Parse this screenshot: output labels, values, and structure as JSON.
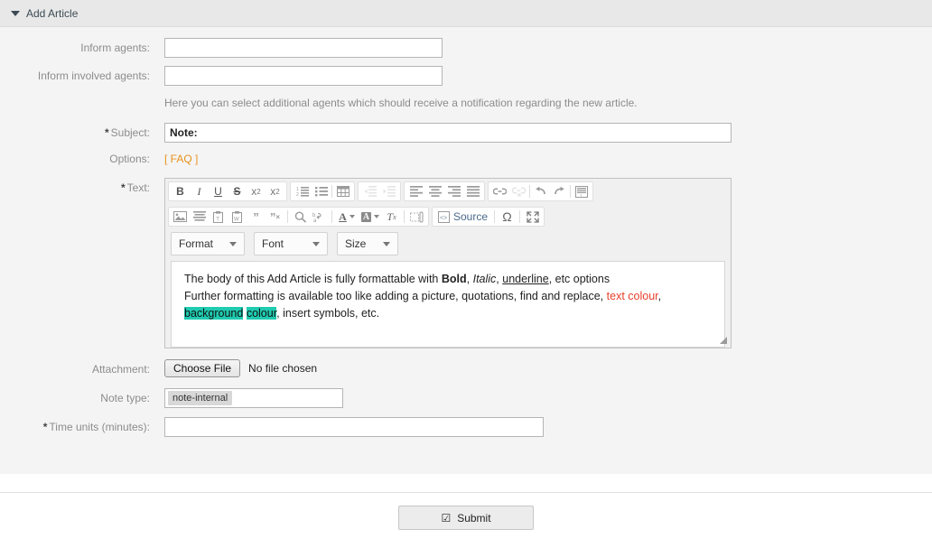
{
  "widget": {
    "title": "Add Article",
    "collapse_icon": "caret-down-icon"
  },
  "form": {
    "inform_agents": {
      "label": "Inform agents:",
      "value": ""
    },
    "inform_involved_agents": {
      "label": "Inform involved agents:",
      "value": ""
    },
    "hint": "Here you can select additional agents which should receive a notification regarding the new article.",
    "subject": {
      "label": "Subject:",
      "required_marker": "*",
      "value": "Note:"
    },
    "options": {
      "label": "Options:",
      "faq_link": "[ FAQ ]",
      "link_color": "#e8921f"
    },
    "text": {
      "label": "Text:",
      "required_marker": "*"
    },
    "attachment": {
      "label": "Attachment:",
      "button": "Choose File",
      "status": "No file chosen"
    },
    "note_type": {
      "label": "Note type:",
      "token": "note-internal"
    },
    "time_units": {
      "label": "Time units (minutes):",
      "required_marker": "*",
      "value": ""
    }
  },
  "editor": {
    "toolbar_row1": [
      {
        "name": "bold-icon",
        "glyph": "B",
        "disabled": false
      },
      {
        "name": "italic-icon",
        "glyph": "I",
        "disabled": false
      },
      {
        "name": "underline-icon",
        "glyph": "U",
        "disabled": false
      },
      {
        "name": "strikethrough-icon",
        "glyph": "S",
        "disabled": false
      },
      {
        "name": "subscript-icon",
        "glyph": "x₂",
        "disabled": false
      },
      {
        "name": "superscript-icon",
        "glyph": "x²",
        "disabled": false
      }
    ],
    "toolbar_lists": [
      {
        "name": "numbered-list-icon",
        "disabled": false
      },
      {
        "name": "bulleted-list-icon",
        "disabled": false
      },
      {
        "name": "table-icon",
        "disabled": false
      }
    ],
    "toolbar_indent": [
      {
        "name": "decrease-indent-icon",
        "disabled": true
      },
      {
        "name": "increase-indent-icon",
        "disabled": true
      }
    ],
    "toolbar_align": [
      {
        "name": "align-left-icon",
        "disabled": false
      },
      {
        "name": "align-center-icon",
        "disabled": false
      },
      {
        "name": "align-right-icon",
        "disabled": false
      },
      {
        "name": "align-justify-icon",
        "disabled": false
      }
    ],
    "toolbar_link": [
      {
        "name": "link-icon",
        "disabled": false
      },
      {
        "name": "unlink-icon",
        "disabled": true
      }
    ],
    "toolbar_history": [
      {
        "name": "undo-icon",
        "disabled": false
      },
      {
        "name": "redo-icon",
        "disabled": false
      }
    ],
    "toolbar_row2": [
      {
        "name": "image-icon",
        "disabled": false
      },
      {
        "name": "justify-block-icon",
        "disabled": false
      },
      {
        "name": "paste-text-icon",
        "disabled": false
      },
      {
        "name": "paste-word-icon",
        "disabled": false
      },
      {
        "name": "blockquote-icon",
        "disabled": false
      },
      {
        "name": "remove-quote-icon",
        "disabled": false
      },
      {
        "name": "find-icon",
        "disabled": false
      },
      {
        "name": "replace-icon",
        "disabled": false
      },
      {
        "name": "text-colour-icon",
        "disabled": false
      },
      {
        "name": "background-colour-icon",
        "disabled": false
      },
      {
        "name": "remove-format-icon",
        "disabled": false
      },
      {
        "name": "page-break-icon",
        "disabled": false
      }
    ],
    "source_button": "Source",
    "special_char_icon": "omega-icon",
    "maximize_icon": "maximize-icon",
    "dropdowns": [
      {
        "name": "format-dropdown",
        "label": "Format"
      },
      {
        "name": "font-dropdown",
        "label": "Font"
      },
      {
        "name": "size-dropdown",
        "label": "Size"
      }
    ],
    "body": {
      "line1_a": "The body of this Add Article is fully formattable with ",
      "line1_bold": "Bold",
      "line1_b": ", ",
      "line1_italic": "Italic",
      "line1_c": ", ",
      "line1_underline": "underline",
      "line1_d": ", etc options",
      "line2_a": "Further formatting is available too like adding a picture, quotations, find and replace, ",
      "line2_red": "text colour",
      "line2_b": ", ",
      "line2_hl1": "background",
      "line2_c": " ",
      "line2_hl2": "colour",
      "line2_d": ", insert symbols, etc.",
      "text_colour": "#e8402b",
      "background_colour": "#1fcbb0"
    }
  },
  "footer": {
    "submit_label": "Submit",
    "submit_icon": "checkbox-checked-icon"
  }
}
